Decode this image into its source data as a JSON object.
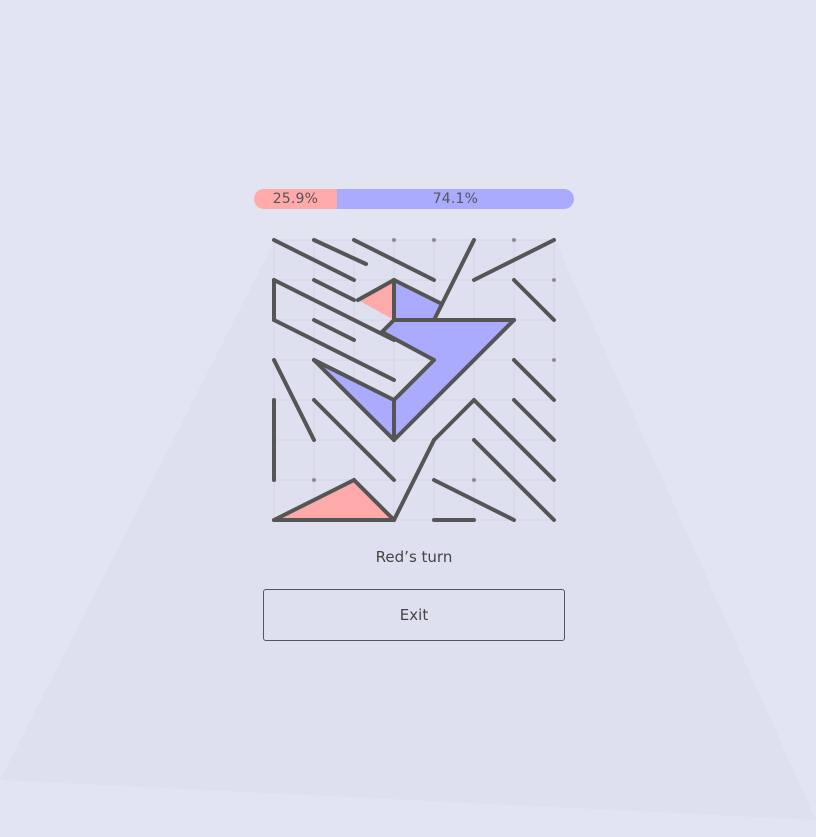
{
  "score": {
    "red": {
      "label": "25.9%",
      "fraction": 0.259,
      "color": "#ffaaaa"
    },
    "blue": {
      "label": "74.1%",
      "fraction": 0.741,
      "color": "#aaaaff"
    }
  },
  "status": {
    "turn_text": "Red’s turn"
  },
  "actions": {
    "exit_label": "Exit"
  },
  "board": {
    "grid_size": 7,
    "line_color": "#555555",
    "red_fill": "#ffaaaa",
    "blue_fill": "#aaaaff",
    "red_regions": [
      [
        [
          2.1,
          1.5
        ],
        [
          3,
          1
        ],
        [
          3,
          2
        ]
      ],
      [
        [
          0,
          7
        ],
        [
          2,
          6
        ],
        [
          3,
          7
        ]
      ]
    ],
    "blue_regions": [
      [
        [
          3,
          1
        ],
        [
          4.2,
          1.6
        ],
        [
          4,
          2
        ],
        [
          3,
          2
        ]
      ],
      [
        [
          3,
          2
        ],
        [
          6,
          2
        ],
        [
          3,
          5
        ],
        [
          1,
          3
        ],
        [
          3,
          4
        ],
        [
          4,
          3
        ],
        [
          2.7,
          2.3
        ]
      ]
    ],
    "segments": [
      [
        [
          0,
          0
        ],
        [
          2,
          1
        ]
      ],
      [
        [
          1,
          0
        ],
        [
          2.3,
          0.6
        ]
      ],
      [
        [
          2,
          0
        ],
        [
          4,
          1
        ]
      ],
      [
        [
          5,
          0
        ],
        [
          4,
          2
        ]
      ],
      [
        [
          7,
          0
        ],
        [
          5,
          1
        ]
      ],
      [
        [
          0,
          1
        ],
        [
          0,
          2
        ]
      ],
      [
        [
          0,
          1
        ],
        [
          3,
          2.5
        ]
      ],
      [
        [
          1,
          1
        ],
        [
          2,
          1.5
        ]
      ],
      [
        [
          2.1,
          1.5
        ],
        [
          3,
          1
        ]
      ],
      [
        [
          3,
          1
        ],
        [
          3,
          2
        ]
      ],
      [
        [
          3,
          1
        ],
        [
          4.2,
          1.6
        ]
      ],
      [
        [
          3,
          2
        ],
        [
          6,
          2
        ]
      ],
      [
        [
          6,
          2
        ],
        [
          3,
          5
        ]
      ],
      [
        [
          6,
          1
        ],
        [
          7,
          2
        ]
      ],
      [
        [
          0,
          2
        ],
        [
          3,
          3.5
        ]
      ],
      [
        [
          1,
          2
        ],
        [
          2,
          2.5
        ]
      ],
      [
        [
          3,
          2
        ],
        [
          2.7,
          2.3
        ]
      ],
      [
        [
          2.7,
          2.3
        ],
        [
          4,
          3
        ]
      ],
      [
        [
          4,
          3
        ],
        [
          3,
          4
        ]
      ],
      [
        [
          3,
          4
        ],
        [
          1,
          3
        ]
      ],
      [
        [
          1,
          3
        ],
        [
          3,
          5
        ]
      ],
      [
        [
          1,
          3
        ],
        [
          2,
          3.5
        ]
      ],
      [
        [
          3,
          4
        ],
        [
          3,
          5
        ]
      ],
      [
        [
          0,
          3
        ],
        [
          1,
          5
        ]
      ],
      [
        [
          0,
          4
        ],
        [
          0,
          6
        ]
      ],
      [
        [
          1,
          4
        ],
        [
          3,
          6
        ]
      ],
      [
        [
          6,
          3
        ],
        [
          7,
          4
        ]
      ],
      [
        [
          6,
          4
        ],
        [
          7,
          5
        ]
      ],
      [
        [
          5,
          4
        ],
        [
          7,
          6
        ]
      ],
      [
        [
          5,
          5
        ],
        [
          7,
          7
        ]
      ],
      [
        [
          5,
          4
        ],
        [
          4,
          5
        ]
      ],
      [
        [
          4,
          5
        ],
        [
          3,
          7
        ]
      ],
      [
        [
          0,
          7
        ],
        [
          2,
          6
        ]
      ],
      [
        [
          2,
          6
        ],
        [
          3,
          7
        ]
      ],
      [
        [
          0,
          7
        ],
        [
          3,
          7
        ]
      ],
      [
        [
          4,
          6
        ],
        [
          6,
          7
        ]
      ],
      [
        [
          4,
          7
        ],
        [
          5,
          7
        ]
      ]
    ],
    "dots": [
      [
        3,
        0
      ],
      [
        4,
        0
      ],
      [
        6,
        0
      ],
      [
        7,
        1
      ],
      [
        7,
        3
      ],
      [
        1,
        6
      ],
      [
        5,
        6
      ]
    ]
  }
}
